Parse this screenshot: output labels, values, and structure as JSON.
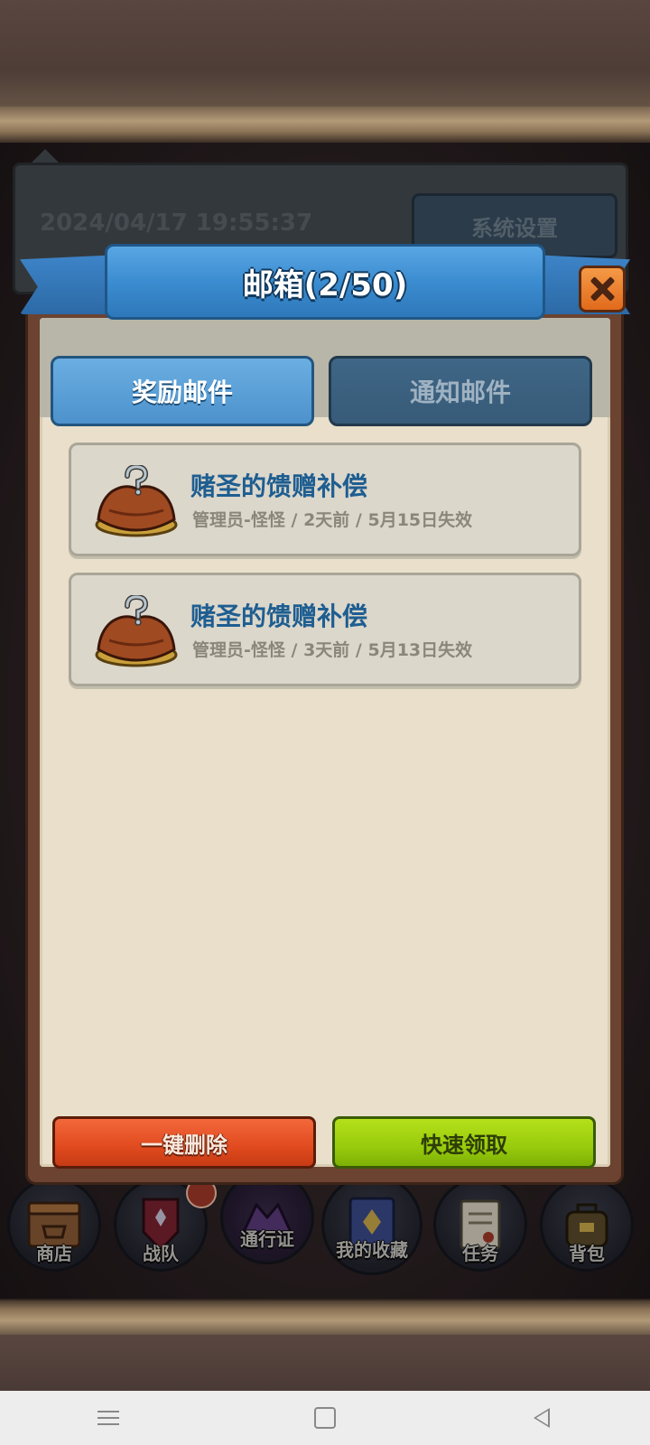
{
  "background": {
    "settings": {
      "datetime": "2024/04/17 19:55:37",
      "button_label": "系统设置"
    },
    "bottom_menu": [
      {
        "label": "商店",
        "icon": "shop-icon"
      },
      {
        "label": "战队",
        "icon": "team-icon"
      },
      {
        "label": "通行证",
        "icon": "pass-icon"
      },
      {
        "label": "我的收藏",
        "icon": "collection-icon"
      },
      {
        "label": "任务",
        "icon": "task-icon"
      },
      {
        "label": "背包",
        "icon": "backpack-icon"
      }
    ]
  },
  "mailbox": {
    "title": "邮箱(2/50)",
    "close_icon": "close-icon",
    "tabs": [
      {
        "label": "奖励邮件",
        "active": true
      },
      {
        "label": "通知邮件",
        "active": false
      }
    ],
    "mails": [
      {
        "title": "赌圣的馈赠补偿",
        "sender": "管理员-怪怪",
        "sep1": " / ",
        "age": "2天前",
        "sep2": " / ",
        "expiry": "5月15日失效",
        "icon": "mystery-chest-icon"
      },
      {
        "title": "赌圣的馈赠补偿",
        "sender": "管理员-怪怪",
        "sep1": " / ",
        "age": "3天前",
        "sep2": " / ",
        "expiry": "5月13日失效",
        "icon": "mystery-chest-icon"
      }
    ],
    "actions": {
      "delete_all": "一键删除",
      "quick_claim": "快速领取"
    }
  },
  "colors": {
    "accent_blue": "#3b8cd0",
    "delete_red": "#e04a1e",
    "claim_green": "#98cb0c",
    "mail_title": "#1e5e91"
  }
}
